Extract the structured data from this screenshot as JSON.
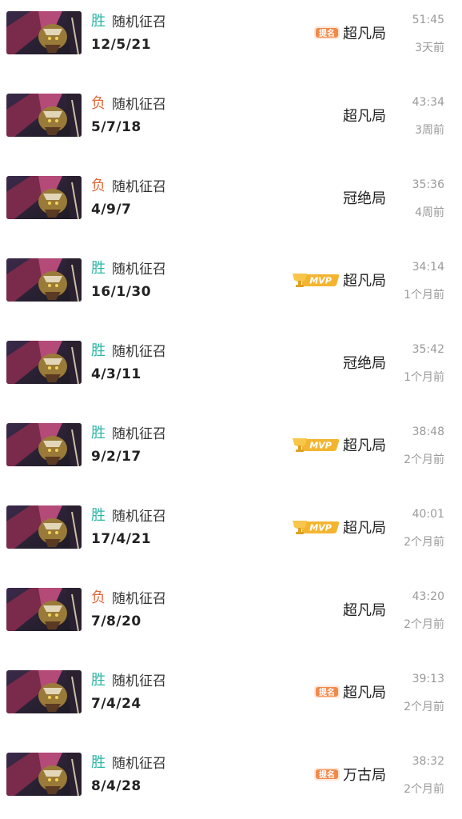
{
  "colors": {
    "win": "#2bb5a3",
    "loss": "#e3683a",
    "muted": "#9a9a9a",
    "mvp_gold": "#f3b531",
    "tag_orange": "#f08a4b"
  },
  "matches": [
    {
      "result": "胜",
      "result_type": "win",
      "mode": "随机征召",
      "kda": "12/5/21",
      "badge": "提名",
      "badge_type": "timing",
      "tier": "超凡局",
      "duration": "51:45",
      "ago": "3天前"
    },
    {
      "result": "负",
      "result_type": "loss",
      "mode": "随机征召",
      "kda": "5/7/18",
      "badge": "",
      "badge_type": "none",
      "tier": "超凡局",
      "duration": "43:34",
      "ago": "3周前"
    },
    {
      "result": "负",
      "result_type": "loss",
      "mode": "随机征召",
      "kda": "4/9/7",
      "badge": "",
      "badge_type": "none",
      "tier": "冠绝局",
      "duration": "35:36",
      "ago": "4周前"
    },
    {
      "result": "胜",
      "result_type": "win",
      "mode": "随机征召",
      "kda": "16/1/30",
      "badge": "MVP",
      "badge_type": "mvp",
      "tier": "超凡局",
      "duration": "34:14",
      "ago": "1个月前"
    },
    {
      "result": "胜",
      "result_type": "win",
      "mode": "随机征召",
      "kda": "4/3/11",
      "badge": "",
      "badge_type": "none",
      "tier": "冠绝局",
      "duration": "35:42",
      "ago": "1个月前"
    },
    {
      "result": "胜",
      "result_type": "win",
      "mode": "随机征召",
      "kda": "9/2/17",
      "badge": "MVP",
      "badge_type": "mvp",
      "tier": "超凡局",
      "duration": "38:48",
      "ago": "2个月前"
    },
    {
      "result": "胜",
      "result_type": "win",
      "mode": "随机征召",
      "kda": "17/4/21",
      "badge": "MVP",
      "badge_type": "mvp",
      "tier": "超凡局",
      "duration": "40:01",
      "ago": "2个月前"
    },
    {
      "result": "负",
      "result_type": "loss",
      "mode": "随机征召",
      "kda": "7/8/20",
      "badge": "",
      "badge_type": "none",
      "tier": "超凡局",
      "duration": "43:20",
      "ago": "2个月前"
    },
    {
      "result": "胜",
      "result_type": "win",
      "mode": "随机征召",
      "kda": "7/4/24",
      "badge": "提名",
      "badge_type": "timing",
      "tier": "超凡局",
      "duration": "39:13",
      "ago": "2个月前"
    },
    {
      "result": "胜",
      "result_type": "win",
      "mode": "随机征召",
      "kda": "8/4/28",
      "badge": "提名",
      "badge_type": "timing",
      "tier": "万古局",
      "duration": "38:32",
      "ago": "2个月前"
    }
  ]
}
